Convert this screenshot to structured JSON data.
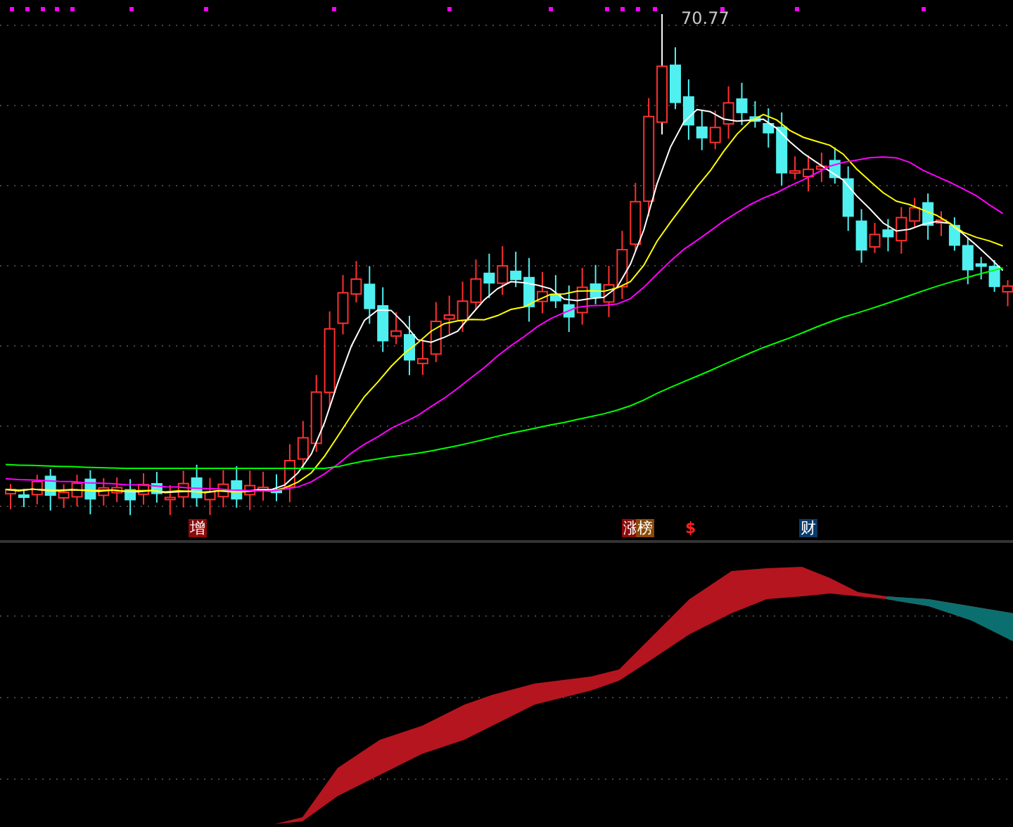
{
  "price_chart": {
    "high_label": "70.77"
  },
  "signals": [
    {
      "text": "增",
      "kind": "badge",
      "color": "#8b0a0a"
    },
    {
      "text": "涨",
      "kind": "badge",
      "color": "#8b0a0a"
    },
    {
      "text": "榜",
      "kind": "badge",
      "color": "#8a4a06"
    },
    {
      "text": "$",
      "kind": "symbol",
      "color": "#ff2020"
    },
    {
      "text": "财",
      "kind": "badge",
      "color": "#0b3a6a"
    }
  ]
}
